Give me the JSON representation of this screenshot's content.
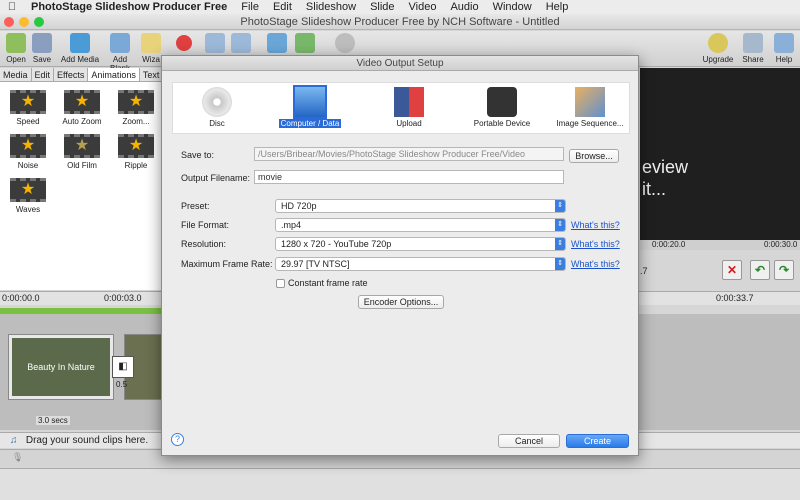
{
  "menubar": {
    "app_name": "PhotoStage Slideshow Producer Free",
    "items": [
      "File",
      "Edit",
      "Slideshow",
      "Slide",
      "Video",
      "Audio",
      "Window",
      "Help"
    ]
  },
  "window": {
    "title": "PhotoStage Slideshow Producer Free by NCH Software - Untitled"
  },
  "toolbar": {
    "open": "Open",
    "save": "Save",
    "add_media": "Add Media",
    "add_blank": "Add Blank",
    "wizard": "Wiza",
    "upgrade": "Upgrade",
    "share": "Share",
    "help": "Help"
  },
  "left_panel": {
    "tabs": [
      "Media",
      "Edit",
      "Effects",
      "Animations",
      "Text"
    ],
    "active_tab": "Animations",
    "animations": [
      "Speed",
      "Auto Zoom",
      "Zoom...",
      "Noise",
      "Old Film",
      "Ripple",
      "Waves"
    ]
  },
  "preview": {
    "text_line1": "eview",
    "text_line2": "it...",
    "time_mid": "0:00:20.0",
    "time_end": "0:00:30.0",
    "time_pos": ".7"
  },
  "timeline": {
    "time_start": "0:00:00.0",
    "time_3": "0:00:03.0",
    "time_right": "0:00:33.7",
    "clip_caption": "Beauty In Nature",
    "transition_value": "0.5",
    "clip_duration": "3.0 secs",
    "sound_hint": "Drag your sound clips here."
  },
  "dialog": {
    "title": "Video Output Setup",
    "destinations": [
      "Disc",
      "Computer / Data",
      "Upload",
      "Portable Device",
      "Image Sequence..."
    ],
    "selected_destination": "Computer / Data",
    "save_to_label": "Save to:",
    "save_to_value": "/Users/Bribear/Movies/PhotoStage Slideshow Producer Free/Video",
    "browse": "Browse...",
    "filename_label": "Output Filename:",
    "filename_value": "movie",
    "preset_label": "Preset:",
    "preset_value": "HD 720p",
    "format_label": "File Format:",
    "format_value": ".mp4",
    "resolution_label": "Resolution:",
    "resolution_value": "1280 x 720 - YouTube 720p",
    "framerate_label": "Maximum Frame Rate:",
    "framerate_value": "29.97 [TV NTSC]",
    "whats_this": "What's this?",
    "constant_frame_rate": "Constant frame rate",
    "encoder_options": "Encoder Options...",
    "cancel": "Cancel",
    "create": "Create",
    "help_glyph": "?"
  },
  "colors": {
    "accent": "#2a6bd8",
    "green": "#7ac143",
    "star": "#f6b400"
  }
}
